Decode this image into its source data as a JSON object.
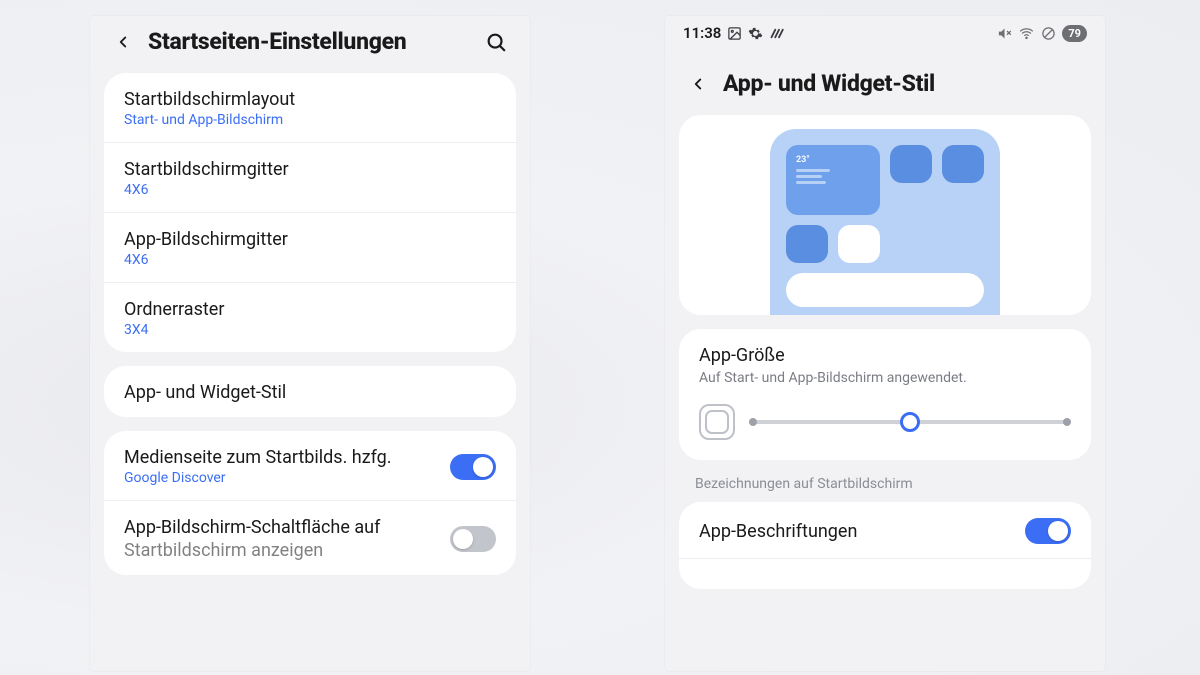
{
  "left": {
    "title": "Startseiten-Einstellungen",
    "rows": {
      "layout": {
        "label": "Startbildschirmlayout",
        "sub": "Start- und App-Bildschirm"
      },
      "homegrid": {
        "label": "Startbildschirmgitter",
        "sub": "4X6"
      },
      "appgrid": {
        "label": "App-Bildschirmgitter",
        "sub": "4X6"
      },
      "foldergrid": {
        "label": "Ordnerraster",
        "sub": "3X4"
      },
      "style": {
        "label": "App- und Widget-Stil"
      },
      "media": {
        "label": "Medienseite zum Startbilds. hzfg.",
        "sub": "Google Discover"
      },
      "appbtn": {
        "label": "App-Bildschirm-Schaltfläche auf",
        "label2": "Startbildschirm anzeigen"
      }
    }
  },
  "right": {
    "status": {
      "time": "11:38",
      "battery": "79"
    },
    "title": "App- und Widget-Stil",
    "preview_temp": "23°",
    "size": {
      "title": "App-Größe",
      "desc": "Auf Start- und App-Bildschirm angewendet."
    },
    "section_label": "Bezeichnungen auf Startbildschirm",
    "app_labels": {
      "label": "App-Beschriftungen"
    }
  }
}
